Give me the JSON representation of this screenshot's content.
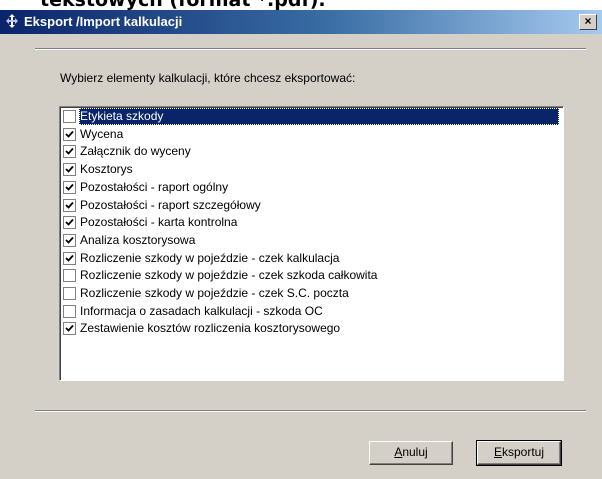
{
  "background_text": "tekstowych (format *.pdf).",
  "window": {
    "title": "Eksport /Import kalkulacji",
    "close_glyph": "×",
    "title_bar_color": "#0a246a"
  },
  "prompt": "Wybierz elementy kalkulacji, które chcesz eksportować:",
  "items": [
    {
      "label": "Etykieta szkody",
      "checked": false,
      "selected": true
    },
    {
      "label": "Wycena",
      "checked": true,
      "selected": false
    },
    {
      "label": "Załącznik do wyceny",
      "checked": true,
      "selected": false
    },
    {
      "label": "Kosztorys",
      "checked": true,
      "selected": false
    },
    {
      "label": "Pozostałości - raport ogólny",
      "checked": true,
      "selected": false
    },
    {
      "label": "Pozostałości - raport szczegółowy",
      "checked": true,
      "selected": false
    },
    {
      "label": "Pozostałości - karta kontrolna",
      "checked": true,
      "selected": false
    },
    {
      "label": "Analiza kosztorysowa",
      "checked": true,
      "selected": false
    },
    {
      "label": "Rozliczenie szkody w pojeździe - czek kalkulacja",
      "checked": true,
      "selected": false
    },
    {
      "label": "Rozliczenie szkody w pojeździe - czek szkoda całkowita",
      "checked": false,
      "selected": false
    },
    {
      "label": "Rozliczenie szkody w pojeździe - czek S.C. poczta",
      "checked": false,
      "selected": false
    },
    {
      "label": "Informacja o zasadach kalkulacji - szkoda OC",
      "checked": false,
      "selected": false
    },
    {
      "label": "Zestawienie kosztów rozliczenia kosztorysowego",
      "checked": true,
      "selected": false
    }
  ],
  "buttons": {
    "cancel": {
      "label": "Anuluj",
      "mnemonic": "A",
      "rest": "nuluj"
    },
    "export": {
      "label": "Eksportuj",
      "mnemonic": "E",
      "rest": "ksportuj"
    }
  },
  "colors": {
    "face": "#d4d0c8",
    "selection": "#0a246a"
  }
}
